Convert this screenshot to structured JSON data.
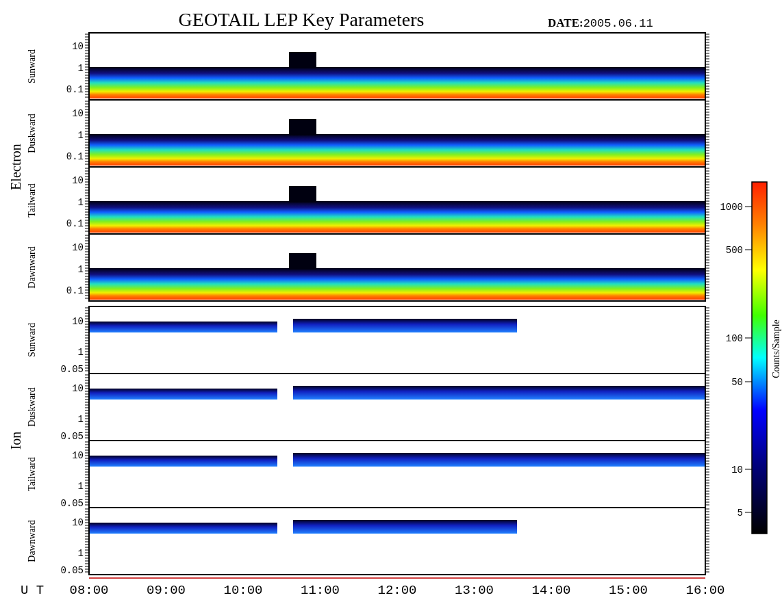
{
  "title": "GEOTAIL LEP Key Parameters",
  "date_label": "DATE:",
  "date": "2005.06.11",
  "groups": [
    {
      "name": "Electron",
      "kind": "electron",
      "panels": [
        {
          "direction": "Sunward",
          "yticks": [
            "10",
            "1",
            "0.1"
          ]
        },
        {
          "direction": "Duskward",
          "yticks": [
            "10",
            "1",
            "0.1"
          ]
        },
        {
          "direction": "Tailward",
          "yticks": [
            "10",
            "1",
            "0.1"
          ]
        },
        {
          "direction": "Dawnward",
          "yticks": [
            "10",
            "1",
            "0.1"
          ]
        }
      ]
    },
    {
      "name": "Ion",
      "kind": "ion",
      "panels": [
        {
          "direction": "Sunward",
          "yticks": [
            "10",
            "1",
            "0.05"
          ]
        },
        {
          "direction": "Duskward",
          "yticks": [
            "10",
            "1",
            "0.05"
          ]
        },
        {
          "direction": "Tailward",
          "yticks": [
            "10",
            "1",
            "0.05"
          ]
        },
        {
          "direction": "Dawnward",
          "yticks": [
            "10",
            "1",
            "0.05"
          ]
        }
      ]
    }
  ],
  "colorbar": {
    "label": "Counts/Sample",
    "ticks": [
      "1000",
      "500",
      "100",
      "50",
      "10",
      "5"
    ]
  },
  "time_axis": {
    "unit": "U T",
    "ticks": [
      "08:00",
      "09:00",
      "10:00",
      "11:00",
      "12:00",
      "13:00",
      "14:00",
      "15:00",
      "16:00"
    ]
  }
}
